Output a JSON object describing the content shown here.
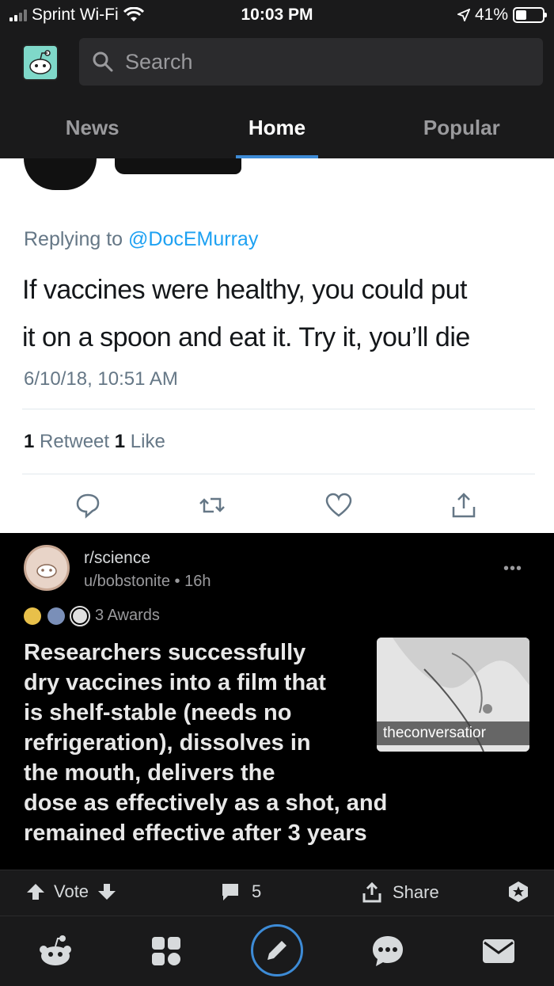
{
  "status_bar": {
    "carrier": "Sprint Wi-Fi",
    "time": "10:03 PM",
    "battery": "41%",
    "battery_level": 0.41
  },
  "header": {
    "search_placeholder": "Search",
    "tabs": [
      {
        "label": "News",
        "active": false
      },
      {
        "label": "Home",
        "active": true
      },
      {
        "label": "Popular",
        "active": false
      }
    ]
  },
  "tweet": {
    "replying_prefix": "Replying to ",
    "replying_handle": "@DocEMurray",
    "body_line1": "If vaccines were healthy, you could put",
    "body_line2": "it on a spoon and eat it. Try it, you’ll die",
    "date": "6/10/18, 10:51 AM",
    "retweet_count": "1",
    "retweet_label": " Retweet ",
    "like_count": "1",
    "like_label": " Like"
  },
  "post": {
    "subreddit": "r/science",
    "meta": "u/bobstonite • 16h",
    "more": "•••",
    "awards": "3 Awards",
    "title_lines": [
      "Researchers successfully",
      "dry vaccines into a film that",
      "is shelf-stable (needs no",
      "refrigeration), dissolves in",
      "the mouth, delivers the",
      "dose as effectively as a shot, and",
      "remained effective after 3 years"
    ],
    "thumbnail_domain": "theconversatior",
    "vote_label": "Vote",
    "comment_count": "5",
    "share_label": "Share"
  },
  "colors": {
    "accent": "#3d8bd6",
    "twitter_blue": "#1da1f2",
    "app_bg": "#1a1a1b"
  }
}
